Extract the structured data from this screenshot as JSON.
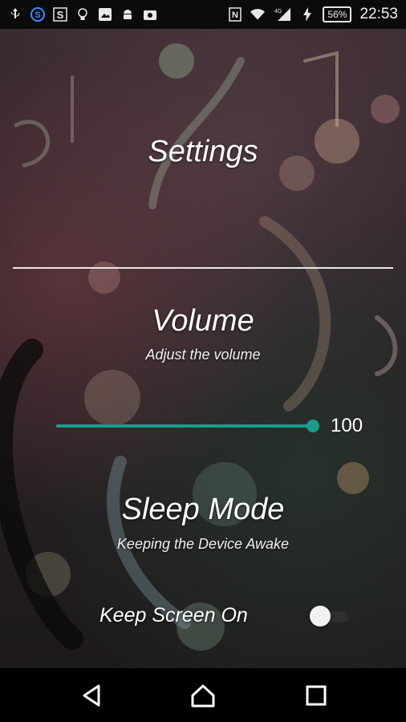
{
  "status_bar": {
    "icons_left": [
      "usb-icon",
      "skype-icon",
      "s-icon",
      "lightbulb-icon",
      "image-icon",
      "android-icon",
      "photo-icon"
    ],
    "icons_right": [
      "nfc-icon",
      "wifi-icon",
      "signal-icon",
      "charging-icon"
    ],
    "network_label": "4G",
    "battery": "56%",
    "time": "22:53"
  },
  "settings": {
    "title": "Settings",
    "volume": {
      "title": "Volume",
      "subtitle": "Adjust the volume",
      "value": 100,
      "value_label": "100",
      "accent": "#1a9c8c"
    },
    "sleep_mode": {
      "title": "Sleep Mode",
      "subtitle": "Keeping the Device Awake",
      "keep_screen_on_label": "Keep Screen On",
      "keep_screen_on": false
    }
  },
  "nav_bar": {
    "buttons": [
      "back-icon",
      "home-icon",
      "recents-icon"
    ]
  }
}
